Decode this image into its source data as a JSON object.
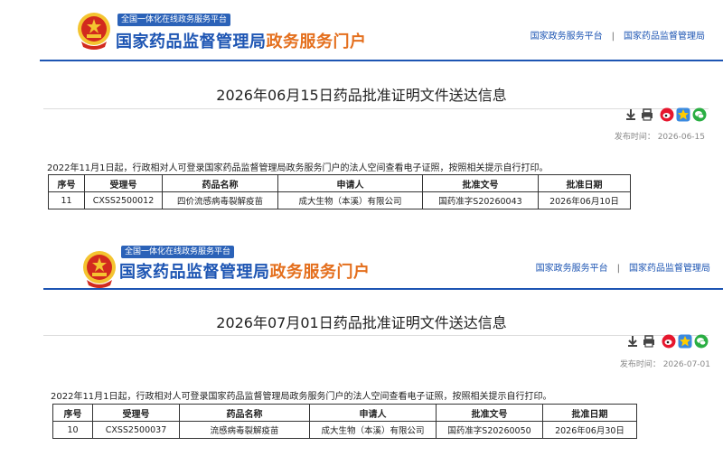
{
  "header": {
    "slogan": "全国一体化在线政务服务平台",
    "brand_part1": "国家药品监督管理局",
    "brand_part2": "政务服务门户",
    "links": [
      "国家政务服务平台",
      "国家药品监督管理局"
    ],
    "separator": "|"
  },
  "colors": {
    "primary": "#1d55b3",
    "accent": "#e46f1d",
    "emblem_red": "#d22a1e",
    "emblem_gold": "#f4c430"
  },
  "icons": [
    "download-icon",
    "print-icon",
    "weibo-icon",
    "qzone-icon",
    "wechat-icon"
  ],
  "documents": [
    {
      "title": "2026年06月15日药品批准证明文件送达信息",
      "pubdate": "发布时间： 2026-06-15",
      "notice": "2022年11月1日起，行政相对人可登录国家药品监督管理局政务服务门户的法人空间查看电子证照，按照相关提示自行打印。",
      "columns": [
        "序号",
        "受理号",
        "药品名称",
        "申请人",
        "批准文号",
        "批准日期"
      ],
      "rows": [
        [
          "11",
          "CXSS2500012",
          "四价流感病毒裂解疫苗",
          "成大生物（本溪）有限公司",
          "国药准字S20260043",
          "2026年06月10日"
        ]
      ]
    },
    {
      "title": "2026年07月01日药品批准证明文件送达信息",
      "pubdate": "发布时间： 2026-07-01",
      "notice": "2022年11月1日起，行政相对人可登录国家药品监督管理局政务服务门户的法人空间查看电子证照，按照相关提示自行打印。",
      "columns": [
        "序号",
        "受理号",
        "药品名称",
        "申请人",
        "批准文号",
        "批准日期"
      ],
      "rows": [
        [
          "10",
          "CXSS2500037",
          "流感病毒裂解疫苗",
          "成大生物（本溪）有限公司",
          "国药准字S20260050",
          "2026年06月30日"
        ]
      ]
    }
  ]
}
